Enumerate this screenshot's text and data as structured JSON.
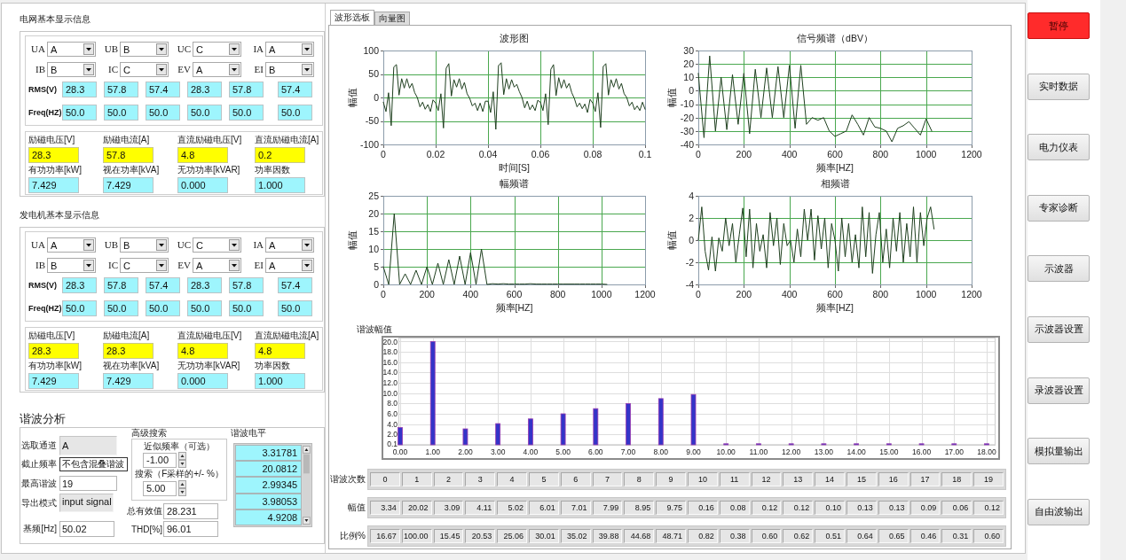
{
  "panels": [
    {
      "title": "电网基本显示信息",
      "selectors": [
        {
          "label": "UA",
          "value": "A"
        },
        {
          "label": "UB",
          "value": "B"
        },
        {
          "label": "UC",
          "value": "C"
        },
        {
          "label": "IA",
          "value": "A"
        },
        {
          "label": "IB",
          "value": "B"
        },
        {
          "label": "IC",
          "value": "C"
        },
        {
          "label": "EV",
          "value": "A"
        },
        {
          "label": "EI",
          "value": "B"
        }
      ],
      "rms": {
        "label": "RMS(V)",
        "values": [
          "28.3",
          "57.8",
          "57.4",
          "28.3",
          "57.8",
          "57.4"
        ]
      },
      "freq": {
        "label": "Freq(HZ)",
        "values": [
          "50.0",
          "50.0",
          "50.0",
          "50.0",
          "50.0",
          "50.0"
        ]
      },
      "excitation": [
        {
          "label": "励磁电压[V]",
          "value": "28.3"
        },
        {
          "label": "励磁电流[A]",
          "value": "57.8"
        },
        {
          "label": "直流励磁电压[V]",
          "value": "4.8"
        },
        {
          "label": "直流励磁电流[A]",
          "value": "0.2"
        }
      ],
      "power": [
        {
          "label": "有功功率[kW]",
          "value": "7.429"
        },
        {
          "label": "视在功率[kVA]",
          "value": "7.429"
        },
        {
          "label": "无功功率[kVAR]",
          "value": "0.000"
        },
        {
          "label": "功率因数",
          "value": "1.000"
        }
      ]
    },
    {
      "title": "发电机基本显示信息",
      "selectors": [
        {
          "label": "UA",
          "value": "A"
        },
        {
          "label": "UB",
          "value": "B"
        },
        {
          "label": "UC",
          "value": "C"
        },
        {
          "label": "IA",
          "value": "A"
        },
        {
          "label": "IB",
          "value": "B"
        },
        {
          "label": "IC",
          "value": "C"
        },
        {
          "label": "EV",
          "value": "A"
        },
        {
          "label": "EI",
          "value": "A"
        }
      ],
      "rms": {
        "label": "RMS(V)",
        "values": [
          "28.3",
          "57.8",
          "57.4",
          "28.3",
          "57.8",
          "57.4"
        ]
      },
      "freq": {
        "label": "Freq(HZ)",
        "values": [
          "50.0",
          "50.0",
          "50.0",
          "50.0",
          "50.0",
          "50.0"
        ]
      },
      "excitation": [
        {
          "label": "励磁电压[V]",
          "value": "28.3"
        },
        {
          "label": "励磁电流[A]",
          "value": "28.3"
        },
        {
          "label": "直流励磁电压[V]",
          "value": "4.8"
        },
        {
          "label": "直流励磁电流[A]",
          "value": "4.8"
        }
      ],
      "power": [
        {
          "label": "有功功率[kW]",
          "value": "7.429"
        },
        {
          "label": "视在功率[kVA]",
          "value": "7.429"
        },
        {
          "label": "无功功率[kVAR]",
          "value": "0.000"
        },
        {
          "label": "功率因数",
          "value": "1.000"
        }
      ]
    }
  ],
  "harmonic_analysis": {
    "title": "谐波分析",
    "settings": [
      {
        "label": "选取通道",
        "value": "A",
        "disabled": true
      },
      {
        "label": "截止频率",
        "value": "不包含混叠谐波",
        "disabled": false
      },
      {
        "label": "最高谐波",
        "value": "19",
        "disabled": false
      },
      {
        "label": "导出模式",
        "value": "input signal",
        "disabled": true
      },
      {
        "label": "基频[Hz]",
        "value": "50.02",
        "disabled": false
      }
    ],
    "advanced_search": {
      "title": "高级搜索",
      "fields": [
        {
          "label": "近似频率（可选）",
          "value": "-1.00"
        },
        {
          "label": "搜索（F采样的+/- %）",
          "value": "5.00"
        }
      ]
    },
    "results": [
      {
        "label": "总有效值",
        "value": "28.231"
      },
      {
        "label": "THD[%]",
        "value": "96.01"
      }
    ],
    "levels": {
      "label": "谐波电平",
      "values": [
        "3.31781",
        "20.0812",
        "2.99345",
        "3.98053",
        "4.9208"
      ]
    }
  },
  "tabs": [
    {
      "label": "波形选板",
      "selected": true
    },
    {
      "label": "向量图",
      "selected": false
    }
  ],
  "charts": [
    {
      "chart_data": {
        "type": "line",
        "title": "波形图",
        "xlabel": "时间[S]",
        "ylabel": "幅值",
        "grid": true,
        "xlim": [
          0,
          0.1
        ],
        "ylim": [
          -100,
          100
        ],
        "xticks": [
          0,
          0.02,
          0.04,
          0.06,
          0.08,
          0.1
        ],
        "yticks": [
          -100,
          -50,
          0,
          50,
          100
        ],
        "x": [
          0,
          0.001,
          0.002,
          0.003,
          0.004,
          0.005,
          0.006,
          0.007,
          0.008,
          0.009,
          0.01,
          0.011,
          0.012,
          0.013,
          0.014,
          0.015,
          0.016,
          0.017,
          0.018,
          0.019,
          0.02,
          0.021,
          0.022,
          0.023,
          0.024,
          0.025,
          0.026,
          0.027,
          0.028,
          0.029,
          0.03,
          0.031,
          0.032,
          0.033,
          0.034,
          0.035,
          0.036,
          0.037,
          0.038,
          0.039,
          0.04,
          0.041,
          0.042,
          0.043,
          0.044,
          0.045,
          0.046,
          0.047,
          0.048,
          0.049,
          0.05,
          0.051,
          0.052,
          0.053,
          0.054,
          0.055,
          0.056,
          0.057,
          0.058,
          0.059,
          0.06,
          0.061,
          0.062,
          0.063,
          0.064,
          0.065,
          0.066,
          0.067,
          0.068,
          0.069,
          0.07,
          0.071,
          0.072,
          0.073,
          0.074,
          0.075,
          0.076,
          0.077,
          0.078,
          0.079,
          0.08,
          0.081,
          0.082,
          0.083,
          0.084,
          0.085,
          0.086,
          0.087,
          0.088,
          0.089,
          0.09,
          0.091,
          0.092,
          0.093,
          0.094,
          0.095,
          0.096,
          0.097,
          0.098,
          0.099,
          0.1
        ],
        "values": [
          -10,
          -30,
          10,
          -60,
          65,
          70,
          5,
          40,
          20,
          40,
          20,
          30,
          10,
          0,
          -20,
          -10,
          -25,
          -15,
          -30,
          -5,
          -12,
          -28,
          8,
          -65,
          62,
          72,
          3,
          38,
          22,
          40,
          18,
          32,
          8,
          -2,
          -18,
          -12,
          -28,
          -12,
          -30,
          -8,
          -8,
          -32,
          12,
          -68,
          68,
          74,
          6,
          40,
          18,
          38,
          22,
          28,
          12,
          0,
          -22,
          -8,
          -26,
          -16,
          -28,
          -6,
          -10,
          -28,
          8,
          -58,
          60,
          70,
          4,
          42,
          20,
          38,
          20,
          30,
          10,
          -2,
          -20,
          -12,
          -24,
          -14,
          -32,
          -4,
          -12,
          -30,
          10,
          -64,
          66,
          72,
          5,
          38,
          22,
          40,
          18,
          30,
          8,
          0,
          -18,
          -10,
          -26,
          -18,
          -28,
          -10,
          -25
        ]
      }
    },
    {
      "chart_data": {
        "type": "line",
        "title": "信号频谱（dBV）",
        "xlabel": "频率[HZ]",
        "ylabel": "幅值",
        "grid": true,
        "xlim": [
          0,
          1200
        ],
        "ylim": [
          -40,
          30
        ],
        "xticks": [
          0,
          200,
          400,
          600,
          800,
          1000,
          1200
        ],
        "yticks": [
          -40,
          -30,
          -20,
          -10,
          0,
          10,
          20,
          30
        ],
        "x": [
          0,
          25,
          50,
          75,
          100,
          125,
          150,
          175,
          200,
          225,
          250,
          275,
          300,
          325,
          350,
          375,
          400,
          425,
          450,
          475,
          500,
          525,
          550,
          575,
          600,
          625,
          650,
          675,
          700,
          725,
          750,
          775,
          800,
          825,
          850,
          875,
          900,
          925,
          950,
          975,
          1000,
          1025
        ],
        "values": [
          13,
          -35,
          26,
          -30,
          10,
          -29,
          12,
          -25,
          13,
          -32,
          16,
          -20,
          17,
          -20,
          18,
          -20,
          19,
          -28,
          19,
          -25,
          -20,
          -22,
          -20,
          -30,
          -34,
          -32,
          -30,
          -18,
          -25,
          -33,
          -20,
          -27,
          -28,
          -30,
          -38,
          -28,
          -26,
          -23,
          -28,
          -33,
          -21,
          -30
        ]
      }
    },
    {
      "chart_data": {
        "type": "line",
        "title": "幅频谱",
        "xlabel": "频率[HZ]",
        "ylabel": "幅值",
        "grid": true,
        "xlim": [
          0,
          1200
        ],
        "ylim": [
          0,
          25
        ],
        "xticks": [
          0,
          200,
          400,
          600,
          800,
          1000,
          1200
        ],
        "yticks": [
          0,
          5,
          10,
          15,
          20,
          25
        ],
        "x": [
          0,
          25,
          50,
          75,
          100,
          125,
          150,
          175,
          200,
          225,
          250,
          275,
          300,
          325,
          350,
          375,
          400,
          425,
          450,
          475,
          500,
          525,
          550,
          575,
          600,
          625,
          650,
          675,
          700,
          725,
          750,
          775,
          800,
          825,
          850,
          875,
          900,
          925,
          950,
          975,
          1000,
          1025
        ],
        "values": [
          5,
          0,
          20,
          0,
          3,
          0,
          4,
          0,
          5,
          0,
          6,
          0,
          7,
          0,
          8,
          0,
          9,
          0,
          10,
          0,
          0.2,
          0.1,
          0.2,
          0.1,
          0.1,
          0.1,
          0.1,
          0.2,
          0.1,
          0.1,
          0.1,
          0.1,
          0.1,
          0.1,
          0.1,
          0.1,
          0.1,
          0.1,
          0.1,
          0.1,
          0.1,
          0
        ]
      }
    },
    {
      "chart_data": {
        "type": "line",
        "title": "相频谱",
        "xlabel": "频率[HZ]",
        "ylabel": "幅值",
        "grid": true,
        "xlim": [
          0,
          1200
        ],
        "ylim": [
          -4,
          4
        ],
        "xticks": [
          0,
          200,
          400,
          600,
          800,
          1000,
          1200
        ],
        "yticks": [
          -4,
          -2,
          0,
          2,
          4
        ],
        "x": [
          0,
          15,
          30,
          45,
          60,
          75,
          90,
          105,
          120,
          135,
          150,
          165,
          180,
          195,
          210,
          225,
          240,
          255,
          270,
          285,
          300,
          315,
          330,
          345,
          360,
          375,
          390,
          405,
          420,
          435,
          450,
          465,
          480,
          495,
          510,
          525,
          540,
          555,
          570,
          585,
          600,
          615,
          630,
          645,
          660,
          675,
          690,
          705,
          720,
          735,
          750,
          765,
          780,
          795,
          810,
          825,
          840,
          855,
          870,
          885,
          900,
          915,
          930,
          945,
          960,
          975,
          990,
          1005,
          1020,
          1035
        ],
        "values": [
          0,
          3,
          -1,
          -2.7,
          0.3,
          -2.8,
          0.2,
          -1,
          2,
          -0.5,
          1.5,
          -2,
          0.5,
          2.9,
          -1.5,
          2.8,
          -2.5,
          1.5,
          -1,
          0.5,
          -2.5,
          2.5,
          -0.5,
          2,
          -2.2,
          1.5,
          -0.5,
          0,
          -2,
          1,
          -1.5,
          2.8,
          0,
          2.8,
          -1.8,
          2.2,
          -0.8,
          2,
          -2.5,
          1.5,
          0,
          -2.8,
          2,
          -1.5,
          1.5,
          -2,
          0.5,
          -2.5,
          3,
          -1.5,
          2.5,
          -3,
          0.5,
          2.5,
          -2,
          1,
          -2.5,
          2,
          -1,
          2.5,
          -2,
          1.5,
          -1.5,
          3,
          -2,
          2.5,
          -0.5,
          2,
          3,
          1
        ]
      }
    }
  ],
  "harmonic_chart": {
    "chart_data": {
      "type": "bar",
      "title": "谐波幅值",
      "grid": true,
      "categories": [
        "0.00",
        "1.00",
        "2.00",
        "3.00",
        "4.00",
        "5.00",
        "6.00",
        "7.00",
        "8.00",
        "9.00",
        "10.00",
        "11.00",
        "12.00",
        "13.00",
        "14.00",
        "15.00",
        "16.00",
        "17.00",
        "18.00"
      ],
      "values": [
        3.34,
        20.02,
        3.09,
        4.11,
        5.02,
        6.01,
        7.01,
        7.99,
        8.95,
        9.75,
        0.16,
        0.08,
        0.12,
        0.12,
        0.1,
        0.13,
        0.13,
        0.09,
        0.06
      ],
      "ylim": [
        0,
        20.6
      ],
      "yticks": [
        {
          "value": 0.1,
          "label": "0.1"
        },
        {
          "value": 2,
          "label": "2.0"
        },
        {
          "value": 4,
          "label": "4.0"
        },
        {
          "value": 6,
          "label": "6.0"
        },
        {
          "value": 8,
          "label": "8.0"
        },
        {
          "value": 10,
          "label": "10.0"
        },
        {
          "value": 12,
          "label": "12.0"
        },
        {
          "value": 14,
          "label": "14.0"
        },
        {
          "value": 16,
          "label": "16.0"
        },
        {
          "value": 18,
          "label": "18.0"
        },
        {
          "value": 20,
          "label": "20.0"
        }
      ]
    }
  },
  "harmonic_table": {
    "rows": [
      {
        "label": "谐波次数",
        "cells": [
          "0",
          "1",
          "2",
          "3",
          "4",
          "5",
          "6",
          "7",
          "8",
          "9",
          "10",
          "11",
          "12",
          "13",
          "14",
          "15",
          "16",
          "17",
          "18",
          "19"
        ]
      },
      {
        "label": "幅值",
        "cells": [
          "3.34",
          "20.02",
          "3.09",
          "4.11",
          "5.02",
          "6.01",
          "7.01",
          "7.99",
          "8.95",
          "9.75",
          "0.16",
          "0.08",
          "0.12",
          "0.12",
          "0.10",
          "0.13",
          "0.13",
          "0.09",
          "0.06",
          "0.12"
        ]
      },
      {
        "label": "比例%",
        "cells": [
          "16.67",
          "100.00",
          "15.45",
          "20.53",
          "25.06",
          "30.01",
          "35.02",
          "39.88",
          "44.68",
          "48.71",
          "0.82",
          "0.38",
          "0.60",
          "0.62",
          "0.51",
          "0.64",
          "0.65",
          "0.46",
          "0.31",
          "0.60"
        ]
      }
    ]
  },
  "nav_buttons": [
    {
      "label": "暂停",
      "on": true
    },
    {
      "label": "实时数据",
      "on": false
    },
    {
      "label": "电力仪表",
      "on": false
    },
    {
      "label": "专家诊断",
      "on": false
    },
    {
      "label": "示波器",
      "on": false
    },
    {
      "label": "示波器设置",
      "on": false
    },
    {
      "label": "录波器设置",
      "on": false
    },
    {
      "label": "模拟量输出",
      "on": false
    },
    {
      "label": "自由波输出",
      "on": false
    }
  ]
}
